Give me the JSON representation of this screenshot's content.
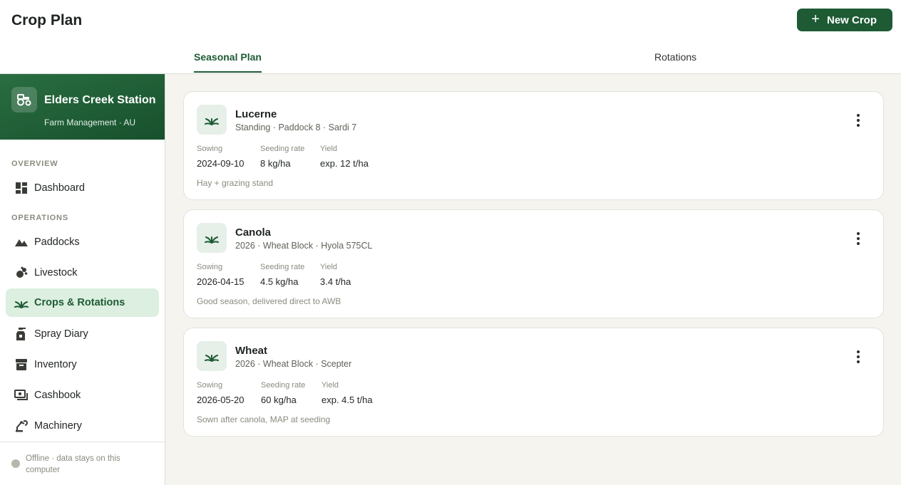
{
  "header": {
    "title": "Crop Plan",
    "new_crop_label": "New Crop"
  },
  "tabs": [
    {
      "label": "Seasonal Plan",
      "active": true
    },
    {
      "label": "Rotations",
      "active": false
    }
  ],
  "farm": {
    "name": "Elders Creek Station",
    "subtitle": "Farm Management · AU"
  },
  "sidebar": {
    "sections": [
      {
        "label": "OVERVIEW"
      },
      {
        "label": "OPERATIONS"
      }
    ],
    "items": [
      {
        "label": "Dashboard",
        "icon": "dashboard-icon"
      },
      {
        "label": "Paddocks",
        "icon": "mountain-icon"
      },
      {
        "label": "Livestock",
        "icon": "livestock-icon"
      },
      {
        "label": "Crops & Rotations",
        "icon": "sprout-icon",
        "active": true
      },
      {
        "label": "Spray Diary",
        "icon": "spray-bottle-icon"
      },
      {
        "label": "Inventory",
        "icon": "archive-box-icon"
      },
      {
        "label": "Cashbook",
        "icon": "cash-icon"
      },
      {
        "label": "Machinery",
        "icon": "machinery-icon"
      }
    ],
    "footer": "Offline · data stays on this computer"
  },
  "crops": [
    {
      "name": "Lucerne",
      "meta": "Standing · Paddock 8 · Sardi 7",
      "stats": [
        {
          "label": "Sowing",
          "value": "2024-09-10"
        },
        {
          "label": "Seeding rate",
          "value": "8 kg/ha"
        },
        {
          "label": "Yield",
          "value": "exp. 12 t/ha"
        }
      ],
      "note": "Hay + grazing stand"
    },
    {
      "name": "Canola",
      "meta": "2026 · Wheat Block · Hyola 575CL",
      "stats": [
        {
          "label": "Sowing",
          "value": "2026-04-15"
        },
        {
          "label": "Seeding rate",
          "value": "4.5 kg/ha"
        },
        {
          "label": "Yield",
          "value": "3.4 t/ha"
        }
      ],
      "note": "Good season, delivered direct to AWB"
    },
    {
      "name": "Wheat",
      "meta": "2026 · Wheat Block · Scepter",
      "stats": [
        {
          "label": "Sowing",
          "value": "2026-05-20"
        },
        {
          "label": "Seeding rate",
          "value": "60 kg/ha"
        },
        {
          "label": "Yield",
          "value": "exp. 4.5 t/ha"
        }
      ],
      "note": "Sown after canola, MAP at seeding"
    }
  ],
  "colors": {
    "brand": "#1e5b34",
    "active_nav_bg": "#dcefe0",
    "main_bg": "#f5f4ef"
  }
}
